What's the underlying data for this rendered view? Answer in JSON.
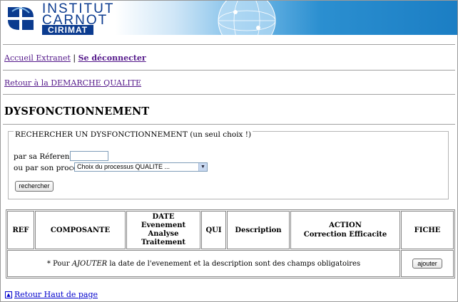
{
  "header": {
    "logo_line1": "INSTITUT",
    "logo_line2": "CARNOT",
    "logo_badge": "CIRIMAT"
  },
  "nav": {
    "home_link": "Accueil Extranet",
    "separator": " | ",
    "logout_link": "Se déconnecter",
    "back_link": "Retour à la DEMARCHE QUALITE"
  },
  "page": {
    "title": "DYSFONCTIONNEMENT"
  },
  "search": {
    "legend": "RECHERCHER UN DYSFONCTIONNEMENT (un seul choix !)",
    "ref_label": "par sa Réference D",
    "ref_value": "",
    "process_label": "ou par son processus",
    "process_selected": "Choix du processus QUALITE ...",
    "button_label": "rechercher"
  },
  "table": {
    "headers": {
      "ref": "REF",
      "composante": "COMPOSANTE",
      "date_l1": "DATE",
      "date_l2": "Evenement",
      "date_l3": "Analyse",
      "date_l4": "Traitement",
      "qui": "QUI",
      "description": "Description",
      "action_l1": "ACTION",
      "action_l2": "Correction Efficacite",
      "fiche": "FICHE"
    },
    "note_prefix": "* Pour ",
    "note_emphasis": "AJOUTER",
    "note_suffix": " la date de l'evenement et la description sont des champs obligatoires",
    "add_button": "ajouter"
  },
  "footer": {
    "back_top_link": "Retour Haut de page"
  },
  "colors": {
    "brand_navy": "#0b3b8f",
    "banner_blue": "#1b7ec4",
    "visited_link": "#551a8b",
    "link": "#0000cc"
  }
}
